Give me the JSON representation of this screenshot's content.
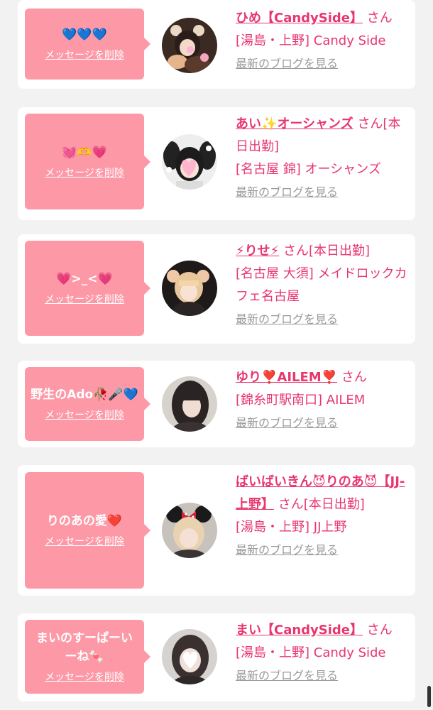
{
  "cards": [
    {
      "message": "💙💙💙",
      "delete_label": "メッセージを削除",
      "name": "ひめ【CandySide】",
      "suffix": "さん",
      "shop": "[湯島・上野] Candy Side",
      "blog_label": "最新のブログを見る",
      "avatar": "avatar-bear-girl"
    },
    {
      "message": "💓🫶💗",
      "delete_label": "メッセージを削除",
      "name": "あい✨オーシャンズ",
      "suffix": "さん[本日出勤]",
      "shop": "[名古屋 錦] オーシャンズ",
      "blog_label": "最新のブログを見る",
      "avatar": "avatar-dalmatian-girl"
    },
    {
      "message": "💗>_<💗",
      "delete_label": "メッセージを削除",
      "name": "⚡りせ⚡",
      "suffix": "さん[本日出勤]",
      "shop": "[名古屋 大須] メイドロックカフェ名古屋",
      "blog_label": "最新のブログを見る",
      "avatar": "avatar-blonde-girl"
    },
    {
      "message": "野生のAdo🥀🎤💙",
      "delete_label": "メッセージを削除",
      "name": "ゆり❣️AILEM❣️",
      "suffix": "さん",
      "shop": "[錦糸町駅南口] AILEM",
      "blog_label": "最新のブログを見る",
      "avatar": "avatar-dark-hair-girl"
    },
    {
      "message": "りのあの愛❤️",
      "delete_label": "メッセージを削除",
      "name": "ばいばいきん😈りのあ😈【JJ-上野】",
      "suffix": "さん[本日出勤]",
      "shop": "[湯島・上野] JJ上野",
      "blog_label": "最新のブログを見る",
      "avatar": "avatar-minnie-ears-girl"
    },
    {
      "message": "まいのすーぱーいーね🍬",
      "delete_label": "メッセージを削除",
      "name": "まい【CandySide】",
      "suffix": "さん",
      "shop": "[湯島・上野] Candy Side",
      "blog_label": "最新のブログを見る",
      "avatar": "avatar-heart-face-girl"
    }
  ],
  "colors": {
    "bubble": "#fd98a7",
    "accent": "#e8366f",
    "link_gray": "#9a9a9a",
    "page_bg": "#f2f2f2"
  }
}
